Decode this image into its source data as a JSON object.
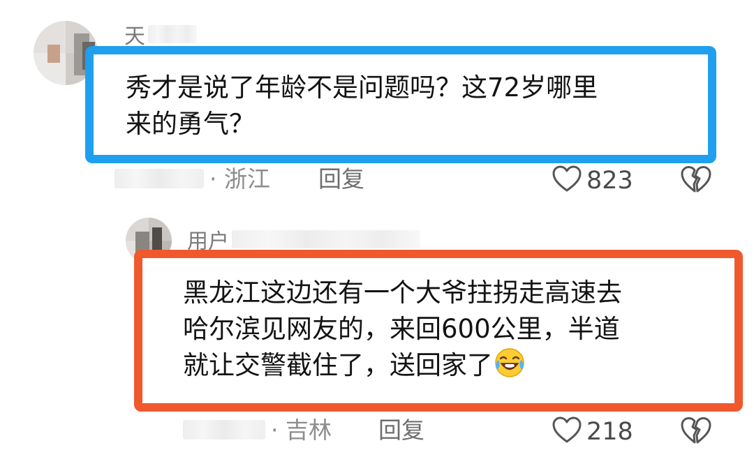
{
  "comments": [
    {
      "name_visible": "天",
      "text": "秀才是说了年龄不是问题吗？这72岁哪里\n来的勇气？",
      "location": "· 浙江",
      "reply_label": "回复",
      "likes": "823",
      "highlight_color": "#1f9fee",
      "like_icon": "heart-outline-icon",
      "dislike_icon": "broken-heart-icon"
    },
    {
      "name_visible": "用户",
      "text": "黑龙江这边还有一个大爷拄拐走高速去\n哈尔滨见网友的，来回600公里，半道\n就让交警截住了，送回家了",
      "emoji": "laughing-crying-face-icon",
      "location": "· 吉林",
      "reply_label": "回复",
      "likes": "218",
      "highlight_color": "#f0582d",
      "like_icon": "heart-outline-icon",
      "dislike_icon": "broken-heart-icon"
    }
  ]
}
